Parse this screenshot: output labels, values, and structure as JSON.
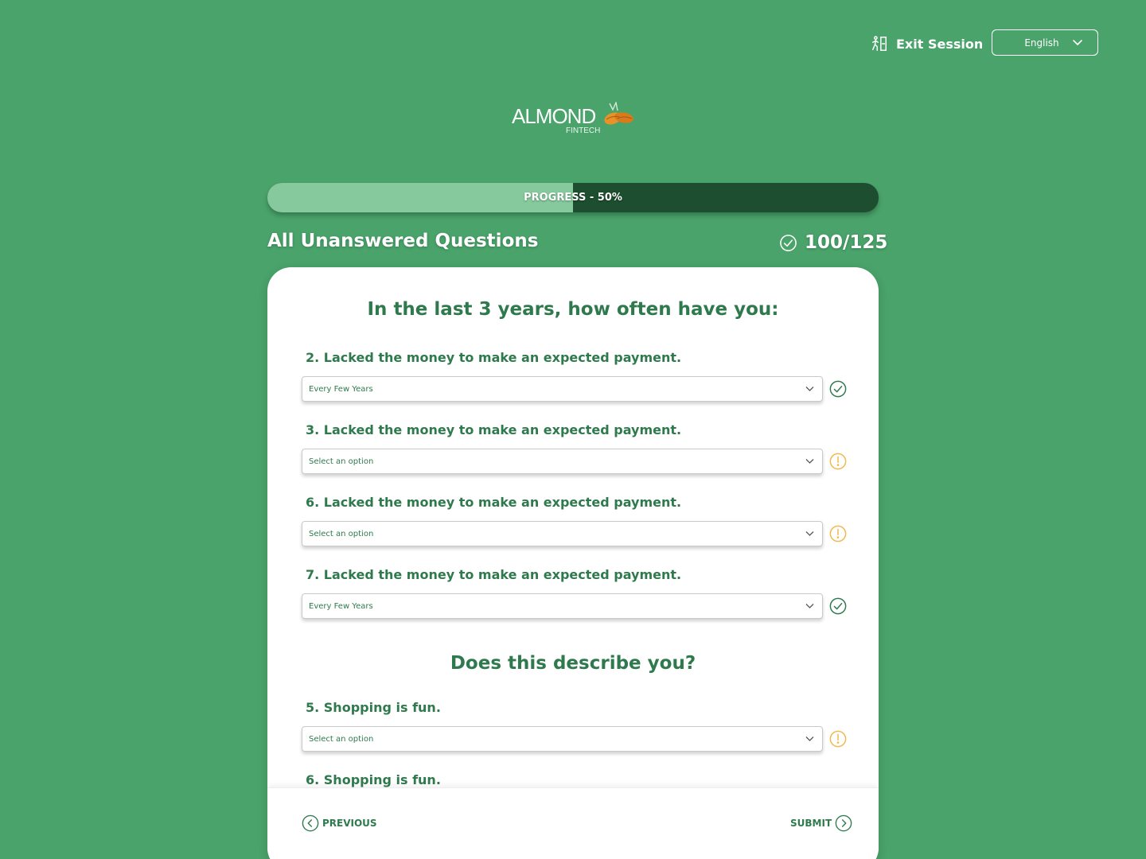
{
  "header": {
    "exit_label": "Exit Session",
    "language": "English"
  },
  "logo": {
    "word": "ALMOND",
    "sub": "FINTECH"
  },
  "progress": {
    "label": "PROGRESS - 50%",
    "percent": 50
  },
  "section": {
    "title": "All Unanswered Questions",
    "counter": "100/125"
  },
  "groups": [
    {
      "heading": "In the last 3 years, how often have you:"
    },
    {
      "heading": "Does this describe you?"
    }
  ],
  "questions": [
    {
      "label": "2. Lacked the money to make an expected payment.",
      "value": "Every Few Years",
      "status": "answered"
    },
    {
      "label": "3. Lacked the money to make an expected payment.",
      "value": "Select an option",
      "status": "unanswered"
    },
    {
      "label": "6. Lacked the money to make an expected payment.",
      "value": "Select an option",
      "status": "unanswered"
    },
    {
      "label": "7. Lacked the money to make an expected payment.",
      "value": "Every Few Years",
      "status": "answered"
    },
    {
      "label": "5. Shopping is fun.",
      "value": "Select an option",
      "status": "unanswered"
    },
    {
      "label": "6. Shopping is fun.",
      "value": "",
      "status": ""
    }
  ],
  "footer": {
    "previous_label": "PREVIOUS",
    "submit_label": "SUBMIT"
  },
  "colors": {
    "background": "#49a36a",
    "primary_text": "#2f7a4d",
    "progress_fill": "#86c99d",
    "progress_track": "#1e4e30",
    "warning": "#f2b84b"
  }
}
